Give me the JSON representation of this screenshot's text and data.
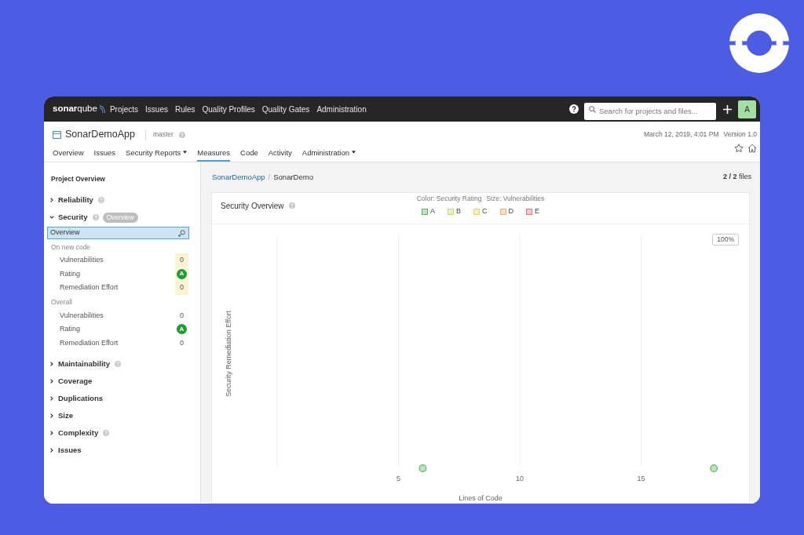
{
  "top_bar": {
    "brand": "**sonar**qube",
    "nav": [
      "Projects",
      "Issues",
      "Rules",
      "Quality Profiles",
      "Quality Gates",
      "Administration"
    ],
    "search": {
      "placeholder": "Search for projects and files..."
    },
    "avatar": "A"
  },
  "project_header": {
    "name": "SonarDemoApp",
    "branch": "master",
    "analysis_date": "March 12, 2019, 4:01 PM",
    "version": "Version 1.0",
    "tabs": [
      {
        "label": "Overview",
        "selected": false,
        "dropdown": false
      },
      {
        "label": "Issues",
        "selected": false,
        "dropdown": false
      },
      {
        "label": "Security Reports",
        "selected": false,
        "dropdown": true
      },
      {
        "label": "Measures",
        "selected": true,
        "dropdown": false
      },
      {
        "label": "Code",
        "selected": false,
        "dropdown": false
      },
      {
        "label": "Activity",
        "selected": false,
        "dropdown": false
      },
      {
        "label": "Administration",
        "selected": false,
        "dropdown": true
      }
    ]
  },
  "sidebar": {
    "title": "Project Overview",
    "categories": [
      {
        "label": "Reliability",
        "help": true,
        "expanded": false
      },
      {
        "label": "Security",
        "help": true,
        "expanded": true,
        "badge": "Overview",
        "overview": {
          "label": "Overview",
          "selected": true
        },
        "groups": [
          {
            "title": "On new code",
            "new_code": true,
            "metrics": [
              {
                "kind": "value",
                "label": "Vulnerabilities",
                "value": "0"
              },
              {
                "kind": "rating",
                "label": "Rating",
                "value": "A",
                "color": "#1e9c35"
              },
              {
                "kind": "value",
                "label": "Remediation Effort",
                "value": "0"
              }
            ]
          },
          {
            "title": "Overall",
            "new_code": false,
            "metrics": [
              {
                "kind": "value",
                "label": "Vulnerabilities",
                "value": "0"
              },
              {
                "kind": "rating",
                "label": "Rating",
                "value": "A",
                "color": "#1e9c35"
              },
              {
                "kind": "value",
                "label": "Remediation Effort",
                "value": "0"
              }
            ]
          }
        ]
      },
      {
        "label": "Maintainability",
        "help": true,
        "expanded": false
      },
      {
        "label": "Coverage",
        "help": false,
        "expanded": false
      },
      {
        "label": "Duplications",
        "help": false,
        "expanded": false
      },
      {
        "label": "Size",
        "help": false,
        "expanded": false
      },
      {
        "label": "Complexity",
        "help": true,
        "expanded": false
      },
      {
        "label": "Issues",
        "help": false,
        "expanded": false
      }
    ]
  },
  "breadcrumb": {
    "separator": "/",
    "items": [
      {
        "label": "SonarDemoApp",
        "kind": "link"
      },
      {
        "label": "SonarDemo",
        "kind": "current"
      }
    ]
  },
  "files_count": "**2 / 2** files",
  "chart_panel": {
    "title": "Security Overview",
    "legend": {
      "color_label": "Color: Security Rating",
      "size_label": "Size: Vulnerabilities",
      "items": [
        {
          "label": "A",
          "color": "#5cb85c"
        },
        {
          "label": "B",
          "color": "#c5dc6a"
        },
        {
          "label": "C",
          "color": "#e3d35a"
        },
        {
          "label": "D",
          "color": "#e8b07a"
        },
        {
          "label": "E",
          "color": "#e07882"
        }
      ]
    },
    "zoom_button": "100%",
    "plot": {
      "xlabel": "Lines of Code",
      "ylabel": "Security Remediation Effort",
      "x_tick_labels": [
        "5",
        "10",
        "15"
      ]
    }
  }
}
